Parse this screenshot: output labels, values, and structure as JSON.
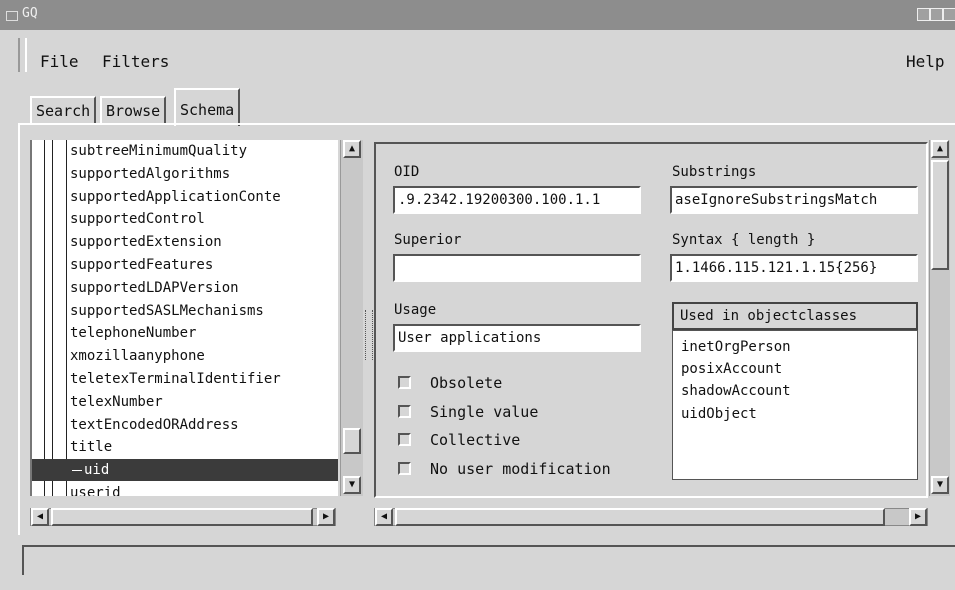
{
  "window": {
    "title": "GQ"
  },
  "menu": {
    "file": "File",
    "filters": "Filters",
    "help": "Help"
  },
  "tabs": [
    {
      "label": "Search",
      "active": false
    },
    {
      "label": "Browse",
      "active": false
    },
    {
      "label": "Schema",
      "active": true
    }
  ],
  "tree": {
    "items": [
      "subtreeMinimumQuality",
      "supportedAlgorithms",
      "supportedApplicationConte",
      "supportedControl",
      "supportedExtension",
      "supportedFeatures",
      "supportedLDAPVersion",
      "supportedSASLMechanisms",
      "telephoneNumber",
      "xmozillaanyphone",
      "teletexTerminalIdentifier",
      "telexNumber",
      "textEncodedORAddress",
      "title",
      "uid",
      "userid"
    ],
    "selected": "uid"
  },
  "detail": {
    "oid_label": "OID",
    "oid_value": ".9.2342.19200300.100.1.1",
    "superior_label": "Superior",
    "superior_value": "",
    "usage_label": "Usage",
    "usage_value": "User applications",
    "substrings_label": "Substrings",
    "substrings_value": "aseIgnoreSubstringsMatch",
    "syntax_label": "Syntax { length }",
    "syntax_value": "1.1466.115.121.1.15{256}",
    "checkboxes": [
      {
        "label": "Obsolete",
        "checked": false
      },
      {
        "label": "Single value",
        "checked": false
      },
      {
        "label": "Collective",
        "checked": false
      },
      {
        "label": "No user modification",
        "checked": false
      }
    ],
    "used_in_header": "Used in objectclasses",
    "used_in": [
      "inetOrgPerson",
      "posixAccount",
      "shadowAccount",
      "uidObject"
    ]
  },
  "icons": {
    "scroll_up": "▲",
    "scroll_down": "▼",
    "scroll_left": "◀",
    "scroll_right": "▶"
  }
}
